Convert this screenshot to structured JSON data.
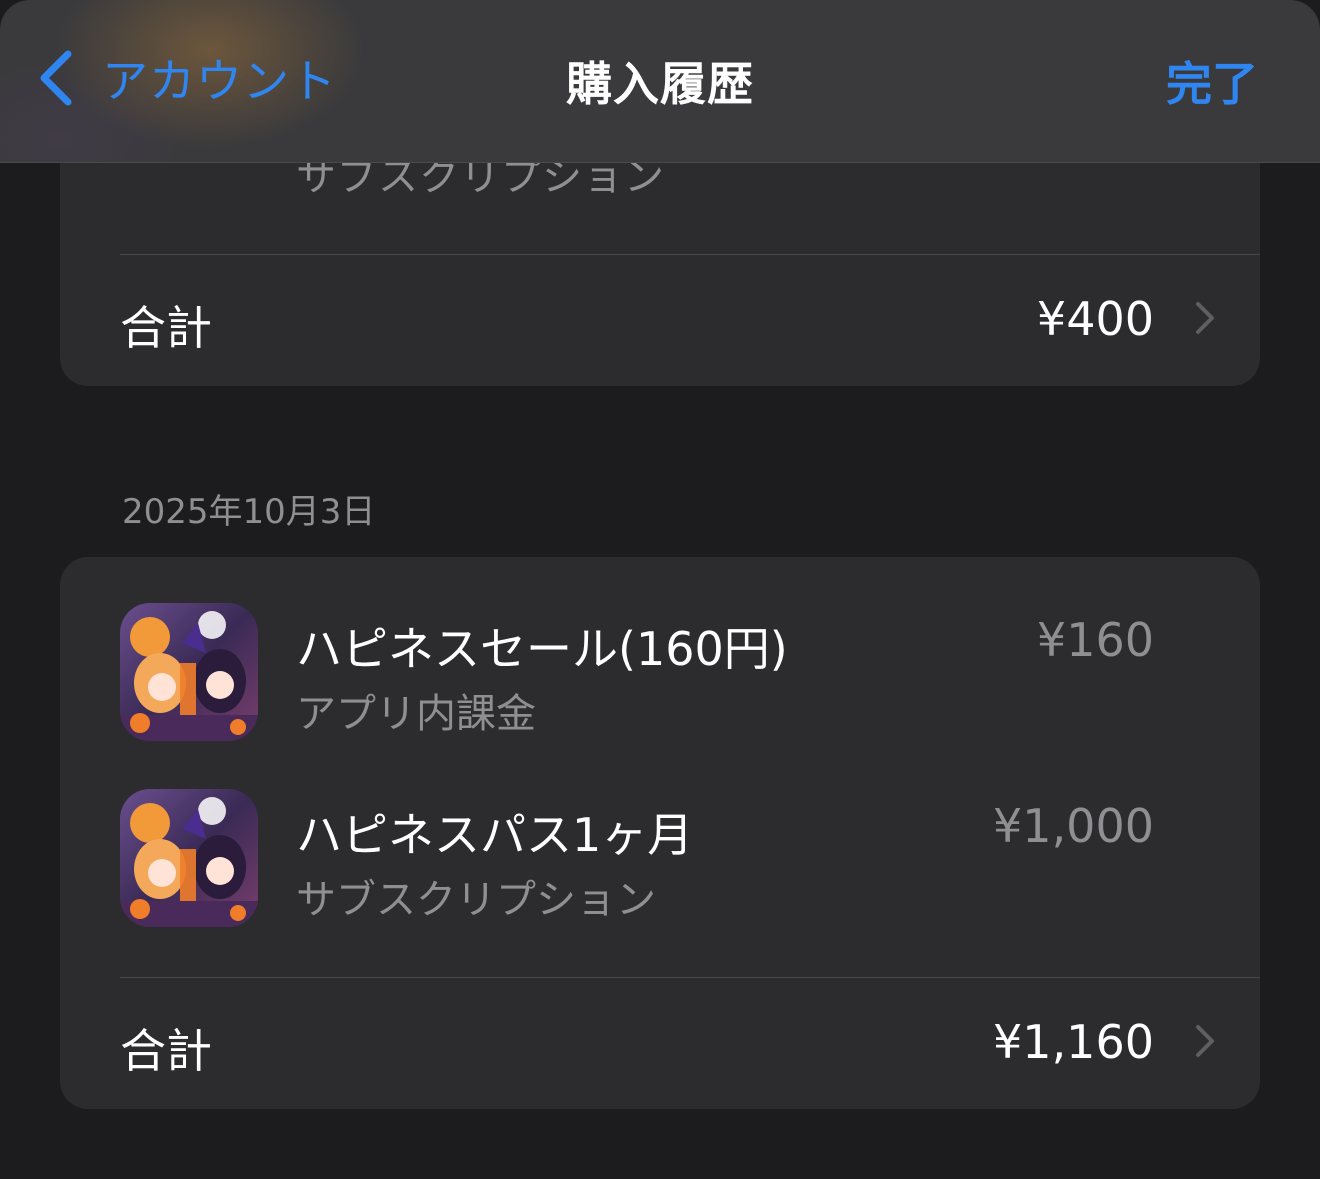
{
  "nav": {
    "back_label": "アカウント",
    "title": "購入履歴",
    "done_label": "完了"
  },
  "previous_group": {
    "partial_item_subtitle": "サブスクリプション",
    "total_label": "合計",
    "total_amount": "¥400"
  },
  "group": {
    "date": "2025年10月3日",
    "items": [
      {
        "title": "ハピネスセール(160円)",
        "subtitle": "アプリ内課金",
        "price": "¥160",
        "icon": "app-icon"
      },
      {
        "title": "ハピネスパス1ヶ月",
        "subtitle": "サブスクリプション",
        "price": "¥1,000",
        "icon": "app-icon"
      }
    ],
    "total_label": "合計",
    "total_amount": "¥1,160"
  },
  "colors": {
    "accent": "#2f86f0",
    "background": "#1c1c1e",
    "card": "#2c2c2e",
    "secondary_text": "#8e8e93"
  }
}
